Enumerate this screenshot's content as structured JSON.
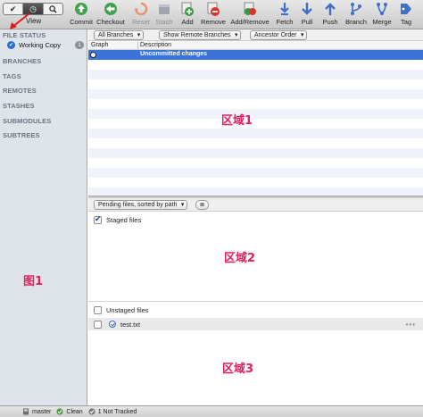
{
  "toolbar": {
    "view_label": "View",
    "buttons": [
      {
        "label": "Commit",
        "icon": "commit-icon",
        "enabled": true
      },
      {
        "label": "Checkout",
        "icon": "checkout-icon",
        "enabled": true
      },
      {
        "label": "Reset",
        "icon": "reset-icon",
        "enabled": false
      },
      {
        "label": "Stash",
        "icon": "stash-icon",
        "enabled": false
      },
      {
        "label": "Add",
        "icon": "add-icon",
        "enabled": true
      },
      {
        "label": "Remove",
        "icon": "remove-icon",
        "enabled": true
      },
      {
        "label": "Add/Remove",
        "icon": "add-remove-icon",
        "enabled": true
      },
      {
        "label": "Fetch",
        "icon": "fetch-icon",
        "enabled": true
      },
      {
        "label": "Pull",
        "icon": "pull-icon",
        "enabled": true
      },
      {
        "label": "Push",
        "icon": "push-icon",
        "enabled": true
      },
      {
        "label": "Branch",
        "icon": "branch-icon",
        "enabled": true
      },
      {
        "label": "Merge",
        "icon": "merge-icon",
        "enabled": true
      },
      {
        "label": "Tag",
        "icon": "tag-icon",
        "enabled": true
      }
    ]
  },
  "sidebar": {
    "file_status": "FILE STATUS",
    "working_copy": "Working Copy",
    "working_copy_count": "1",
    "sections": [
      "BRANCHES",
      "TAGS",
      "REMOTES",
      "STASHES",
      "SUBMODULES",
      "SUBTREES"
    ]
  },
  "history": {
    "branches_filter": "All Branches",
    "remote_filter": "Show Remote Branches",
    "order_filter": "Ancestor Order",
    "col_graph": "Graph",
    "col_description": "Description",
    "selected_row": "Uncommitted changes"
  },
  "staged": {
    "sort_label": "Pending files, sorted by path",
    "list_icon": "≣",
    "header": "Staged files"
  },
  "unstaged": {
    "header": "Unstaged files",
    "files": [
      {
        "name": "test.txt"
      }
    ],
    "more": "•••"
  },
  "status": {
    "branch": "master",
    "clean": "Clean",
    "tracked": "1 Not Tracked"
  },
  "annotations": {
    "region1": "区域1",
    "region2": "区域2",
    "region3": "区域3",
    "figure": "图1"
  },
  "colors": {
    "selection": "#3b73d9",
    "annotation": "#e0205a",
    "sidebar_bg": "#dfe4ea"
  }
}
